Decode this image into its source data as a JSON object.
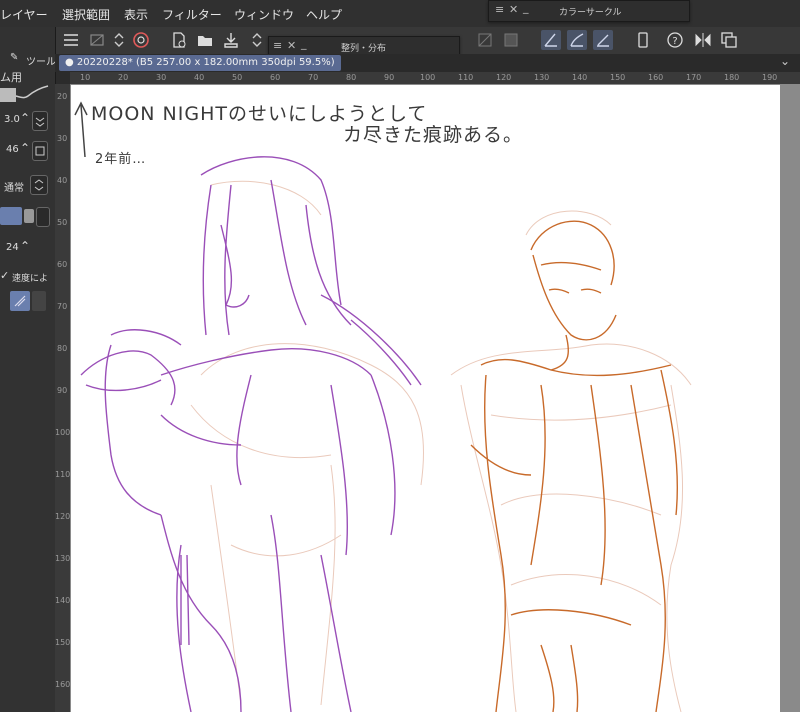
{
  "menubar": {
    "items": [
      "レイヤー",
      "選択範囲",
      "表示",
      "フィルター",
      "ウィンドウ",
      "ヘルプ"
    ]
  },
  "color_circle_panel": {
    "title": "カラーサークル"
  },
  "align_panel": {
    "title": "整列・分布"
  },
  "document_tab": {
    "label": "20220228* (B5 257.00 x 182.00mm 350dpi 59.5%)"
  },
  "tool_property": {
    "header": "ツール",
    "brush_name": "ム用",
    "size_value": "3.0",
    "opacity_value": "46",
    "blend_mode": "通常",
    "stabilization_value": "24",
    "speed_label": "速度によ"
  },
  "ruler": {
    "top_ticks": [
      "10",
      "20",
      "30",
      "40",
      "50",
      "60",
      "70",
      "80",
      "90",
      "100",
      "110",
      "120",
      "130",
      "140",
      "150",
      "160",
      "170",
      "180",
      "190"
    ],
    "left_ticks": [
      "20",
      "30",
      "40",
      "50",
      "60",
      "70",
      "80",
      "90",
      "100",
      "110",
      "120",
      "130",
      "140",
      "150",
      "160"
    ]
  },
  "canvas": {
    "note_line1": "MOON NIGHTのせいにしようとして",
    "note_line2": "カ尽きた痕跡ある。",
    "note_side": "2年前…"
  },
  "colors": {
    "sketch_purple": "#9a4fb8",
    "sketch_orange": "#c86a2a",
    "sketch_pink": "#e8c4b4",
    "accent_blue": "#5a6a92"
  }
}
